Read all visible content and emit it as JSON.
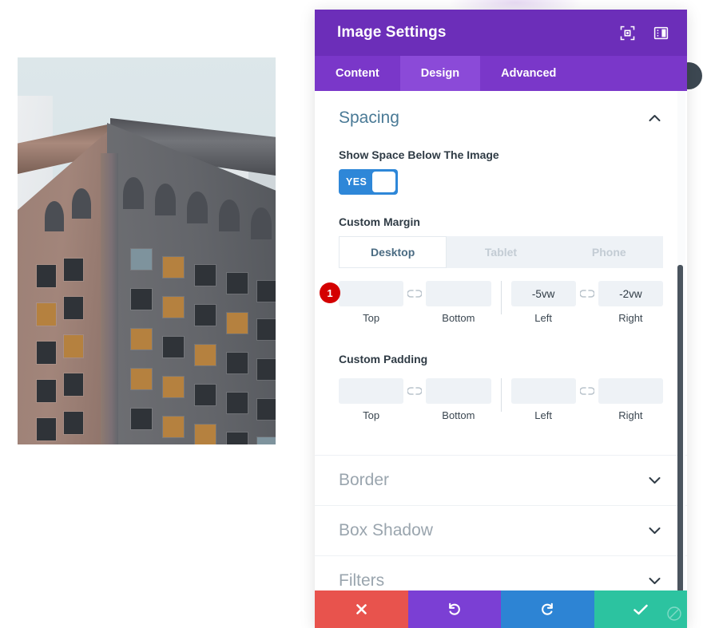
{
  "modal": {
    "title": "Image Settings",
    "header_icons": [
      {
        "name": "expand-icon",
        "glyph": "expand"
      },
      {
        "name": "dock-layout-icon",
        "glyph": "dock"
      }
    ],
    "tabs": [
      {
        "label": "Content",
        "active": false
      },
      {
        "label": "Design",
        "active": true
      },
      {
        "label": "Advanced",
        "active": false
      }
    ],
    "sections": [
      {
        "title": "Spacing",
        "state": "open",
        "chevron": "up"
      },
      {
        "title": "Border",
        "state": "closed",
        "chevron": "down"
      },
      {
        "title": "Box Shadow",
        "state": "closed",
        "chevron": "down"
      },
      {
        "title": "Filters",
        "state": "closed",
        "chevron": "down"
      }
    ],
    "spacing": {
      "toggle_field": {
        "label": "Show Space Below The Image",
        "value": "YES"
      },
      "custom_margin": {
        "label": "Custom Margin",
        "device_tabs": [
          {
            "label": "Desktop",
            "active": true
          },
          {
            "label": "Tablet",
            "active": false
          },
          {
            "label": "Phone",
            "active": false
          }
        ],
        "badge": "1",
        "fields": [
          {
            "caption": "Top",
            "value": "",
            "placeholder": ""
          },
          {
            "caption": "Bottom",
            "value": "",
            "placeholder": ""
          },
          {
            "caption": "Left",
            "value": "-5vw",
            "placeholder": ""
          },
          {
            "caption": "Right",
            "value": "-2vw",
            "placeholder": ""
          }
        ],
        "link_icon": "broken-link"
      },
      "custom_padding": {
        "label": "Custom Padding",
        "fields": [
          {
            "caption": "Top",
            "value": "",
            "placeholder": ""
          },
          {
            "caption": "Bottom",
            "value": "",
            "placeholder": ""
          },
          {
            "caption": "Left",
            "value": "",
            "placeholder": ""
          },
          {
            "caption": "Right",
            "value": "",
            "placeholder": ""
          }
        ],
        "link_icon": "broken-link"
      }
    },
    "footer_buttons": [
      {
        "name": "cancel-button",
        "icon": "close-icon",
        "color": "#e8534d"
      },
      {
        "name": "undo-button",
        "icon": "undo-icon",
        "color": "#7b3fd4"
      },
      {
        "name": "redo-button",
        "icon": "redo-icon",
        "color": "#2d84d4"
      },
      {
        "name": "save-button",
        "icon": "checkmark-icon",
        "color": "#2cc3a0"
      }
    ],
    "colors": {
      "header": "#6c2eb9",
      "tabbar": "#7a37c9",
      "tab_active": "#8b4ad8",
      "section_title": "#4a7a96",
      "toggle_on": "#2e87d8",
      "badge": "#d40000",
      "scrollbar": "#4a545e"
    }
  },
  "canvas": {
    "image": {
      "name": "building-photo",
      "alt": "Corner view of a historic multi-story stone building against a pale blue sky"
    }
  }
}
